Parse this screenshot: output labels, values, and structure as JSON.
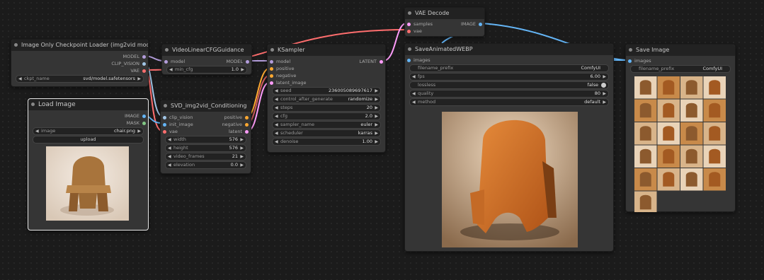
{
  "nodes": {
    "checkpoint": {
      "title": "Image Only Checkpoint Loader (img2vid model)",
      "outputs": [
        "MODEL",
        "CLIP_VISION",
        "VAE"
      ],
      "widget": {
        "label": "ckpt_name",
        "value": "svd/model.safetensors"
      }
    },
    "load_image": {
      "title": "Load Image",
      "outputs": [
        "IMAGE",
        "MASK"
      ],
      "widget": {
        "label": "image",
        "value": "chair.png"
      },
      "upload_label": "upload"
    },
    "video_guidance": {
      "title": "VideoLinearCFGGuidance",
      "inputs": [
        "model"
      ],
      "outputs": [
        "MODEL"
      ],
      "widget": {
        "label": "min_cfg",
        "value": "1.0"
      }
    },
    "svd_conditioning": {
      "title": "SVD_img2vid_Conditioning",
      "inputs": [
        "clip_vision",
        "init_image",
        "vae"
      ],
      "outputs": [
        "positive",
        "negative",
        "latent"
      ],
      "widgets": [
        {
          "label": "width",
          "value": "576"
        },
        {
          "label": "height",
          "value": "576"
        },
        {
          "label": "video_frames",
          "value": "21"
        },
        {
          "label": "elevation",
          "value": "0.0"
        }
      ]
    },
    "ksampler": {
      "title": "KSampler",
      "inputs": [
        "model",
        "positive",
        "negative",
        "latent_image"
      ],
      "outputs": [
        "LATENT"
      ],
      "widgets": [
        {
          "label": "seed",
          "value": "236005089697617"
        },
        {
          "label": "control_after_generate",
          "value": "randomize"
        },
        {
          "label": "steps",
          "value": "20"
        },
        {
          "label": "cfg",
          "value": "2.0"
        },
        {
          "label": "sampler_name",
          "value": "euler"
        },
        {
          "label": "scheduler",
          "value": "karras"
        },
        {
          "label": "denoise",
          "value": "1.00"
        }
      ]
    },
    "vae_decode": {
      "title": "VAE Decode",
      "inputs": [
        "samples",
        "vae"
      ],
      "outputs": [
        "IMAGE"
      ]
    },
    "save_webp": {
      "title": "SaveAnimatedWEBP",
      "inputs": [
        "images"
      ],
      "widgets": [
        {
          "label": "filename_prefix",
          "value": "ComfyUI"
        },
        {
          "label": "fps",
          "value": "6.00"
        },
        {
          "label": "lossless",
          "value": "false"
        },
        {
          "label": "quality",
          "value": "80"
        },
        {
          "label": "method",
          "value": "default"
        }
      ]
    },
    "save_image": {
      "title": "Save Image",
      "inputs": [
        "images"
      ],
      "widget": {
        "label": "filename_prefix",
        "value": "ComfyUI"
      }
    }
  },
  "colors": {
    "model_link": "#b39ddb",
    "clip_vision_link": "#a1c5e6",
    "vae_link": "#ff6e6e",
    "image_link": "#64b5f6",
    "latent_link": "#ff9cf9",
    "conditioning_link": "#ffa931",
    "int_link": "#7ec87e"
  }
}
